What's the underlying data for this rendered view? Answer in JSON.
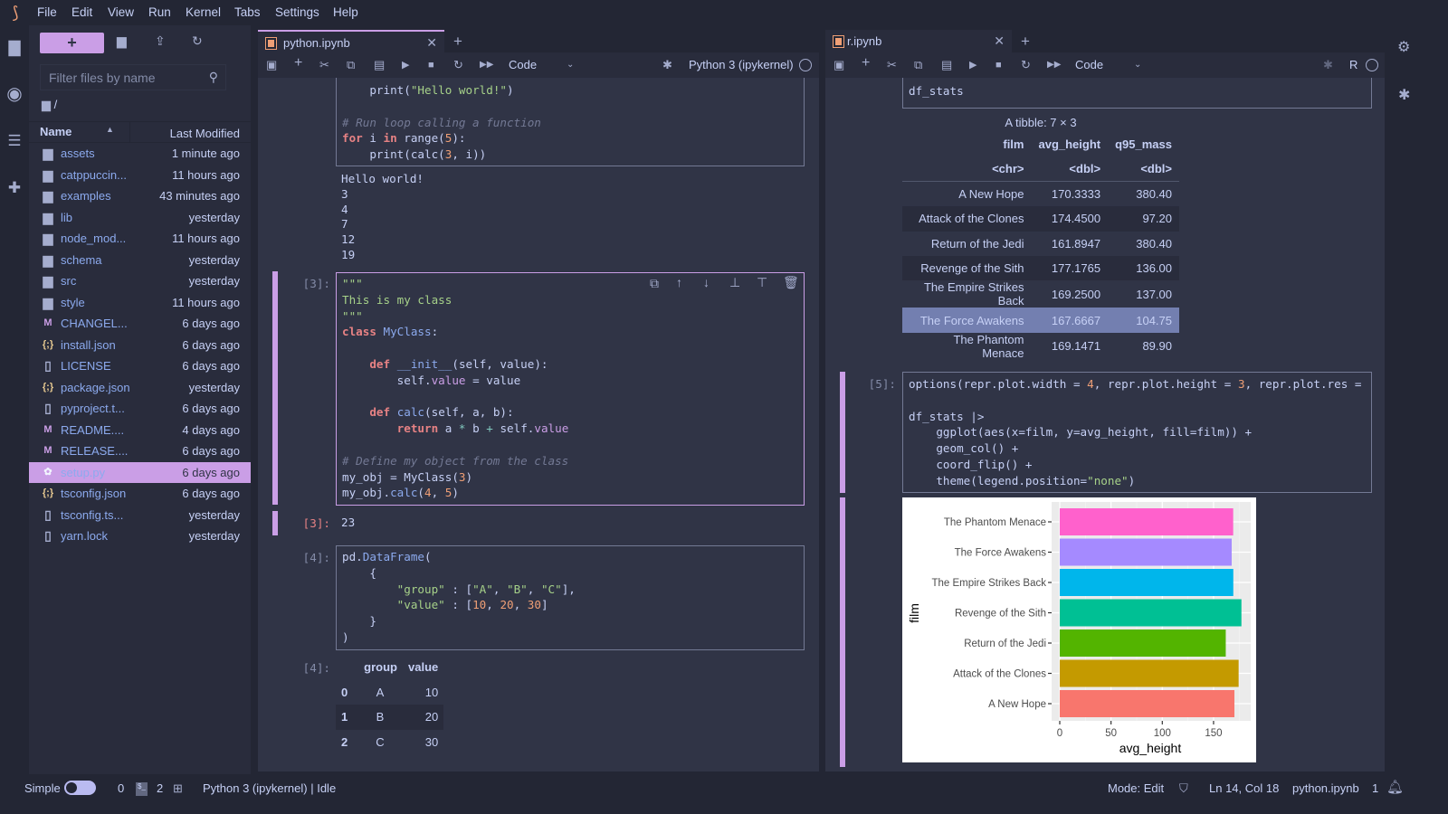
{
  "menu": [
    "File",
    "Edit",
    "View",
    "Run",
    "Kernel",
    "Tabs",
    "Settings",
    "Help"
  ],
  "filebrowser": {
    "filter_placeholder": "Filter files by name",
    "breadcrumb": "/",
    "col_name": "Name",
    "col_modified": "Last Modified",
    "files": [
      {
        "name": "assets",
        "modified": "1 minute ago",
        "type": "folder"
      },
      {
        "name": "catppuccin...",
        "modified": "11 hours ago",
        "type": "folder"
      },
      {
        "name": "examples",
        "modified": "43 minutes ago",
        "type": "folder"
      },
      {
        "name": "lib",
        "modified": "yesterday",
        "type": "folder"
      },
      {
        "name": "node_mod...",
        "modified": "11 hours ago",
        "type": "folder"
      },
      {
        "name": "schema",
        "modified": "yesterday",
        "type": "folder"
      },
      {
        "name": "src",
        "modified": "yesterday",
        "type": "folder"
      },
      {
        "name": "style",
        "modified": "11 hours ago",
        "type": "folder"
      },
      {
        "name": "CHANGEL...",
        "modified": "6 days ago",
        "type": "markdown"
      },
      {
        "name": "install.json",
        "modified": "6 days ago",
        "type": "json"
      },
      {
        "name": "LICENSE",
        "modified": "6 days ago",
        "type": "file"
      },
      {
        "name": "package.json",
        "modified": "yesterday",
        "type": "json"
      },
      {
        "name": "pyproject.t...",
        "modified": "6 days ago",
        "type": "file"
      },
      {
        "name": "README....",
        "modified": "4 days ago",
        "type": "markdown"
      },
      {
        "name": "RELEASE....",
        "modified": "6 days ago",
        "type": "markdown"
      },
      {
        "name": "setup.py",
        "modified": "6 days ago",
        "type": "python",
        "selected": true
      },
      {
        "name": "tsconfig.json",
        "modified": "6 days ago",
        "type": "json"
      },
      {
        "name": "tsconfig.ts...",
        "modified": "yesterday",
        "type": "file"
      },
      {
        "name": "yarn.lock",
        "modified": "yesterday",
        "type": "file"
      }
    ]
  },
  "python_nb": {
    "tab": "python.ipynb",
    "cell_type": "Code",
    "kernel": "Python 3 (ipykernel)",
    "cell1_code": [
      [
        [
          "",
          "    print("
        ],
        [
          "st",
          "\"Hello world!\""
        ],
        [
          "",
          ")"
        ]
      ],
      [],
      [
        [
          "cm",
          "# Run loop calling a function"
        ]
      ],
      [
        [
          "kw",
          "for"
        ],
        [
          "",
          " i "
        ],
        [
          "kw",
          "in"
        ],
        [
          "",
          " range("
        ],
        [
          "nu",
          "5"
        ],
        [
          "",
          "):"
        ]
      ],
      [
        [
          "",
          "    print(calc("
        ],
        [
          "nu",
          "3"
        ],
        [
          "",
          ", i))"
        ]
      ]
    ],
    "cell1_output": [
      "Hello world!",
      "3",
      "4",
      "7",
      "12",
      "19"
    ],
    "cell3_prompt": "[3]:",
    "cell3_code": [
      [
        [
          "st",
          "\"\"\""
        ]
      ],
      [
        [
          "st",
          "This is my class"
        ]
      ],
      [
        [
          "st",
          "\"\"\""
        ]
      ],
      [
        [
          "kw",
          "class"
        ],
        [
          "",
          " "
        ],
        [
          "fn",
          "MyClass"
        ],
        [
          "",
          ":"
        ]
      ],
      [],
      [
        [
          "",
          "    "
        ],
        [
          "kw",
          "def"
        ],
        [
          "",
          " "
        ],
        [
          "fn",
          "__init__"
        ],
        [
          "",
          "(self, value):"
        ]
      ],
      [
        [
          "",
          "        self."
        ],
        [
          "at",
          "value"
        ],
        [
          "",
          " = value"
        ]
      ],
      [],
      [
        [
          "",
          "    "
        ],
        [
          "kw",
          "def"
        ],
        [
          "",
          " "
        ],
        [
          "fn",
          "calc"
        ],
        [
          "",
          "(self, a, b):"
        ]
      ],
      [
        [
          "",
          "        "
        ],
        [
          "kw",
          "return"
        ],
        [
          "",
          " a "
        ],
        [
          "op",
          "*"
        ],
        [
          "",
          " b "
        ],
        [
          "op",
          "+"
        ],
        [
          "",
          " self."
        ],
        [
          "at",
          "value"
        ]
      ],
      [],
      [
        [
          "cm",
          "# Define my object from the class"
        ]
      ],
      [
        [
          "",
          "my_obj = MyClass("
        ],
        [
          "nu",
          "3"
        ],
        [
          "",
          ")"
        ]
      ],
      [
        [
          "",
          "my_obj."
        ],
        [
          "fn",
          "calc"
        ],
        [
          "",
          "("
        ],
        [
          "nu",
          "4"
        ],
        [
          "",
          ", "
        ],
        [
          "nu",
          "5"
        ],
        [
          "",
          ")"
        ]
      ]
    ],
    "cell3_out_prompt": "[3]:",
    "cell3_output": "23",
    "cell4_prompt": "[4]:",
    "cell4_code": [
      [
        [
          "",
          "pd."
        ],
        [
          "fn",
          "DataFrame"
        ],
        [
          "",
          "("
        ]
      ],
      [
        [
          "",
          "    {"
        ]
      ],
      [
        [
          "",
          "        "
        ],
        [
          "st",
          "\"group\""
        ],
        [
          "",
          " : ["
        ],
        [
          "st",
          "\"A\""
        ],
        [
          "",
          ", "
        ],
        [
          "st",
          "\"B\""
        ],
        [
          "",
          ", "
        ],
        [
          "st",
          "\"C\""
        ],
        [
          "",
          "],"
        ]
      ],
      [
        [
          "",
          "        "
        ],
        [
          "st",
          "\"value\""
        ],
        [
          "",
          " : ["
        ],
        [
          "nu",
          "10"
        ],
        [
          "",
          ", "
        ],
        [
          "nu",
          "20"
        ],
        [
          "",
          ", "
        ],
        [
          "nu",
          "30"
        ],
        [
          "",
          "]"
        ]
      ],
      [
        [
          "",
          "    }"
        ]
      ],
      [
        [
          "",
          ")"
        ]
      ]
    ],
    "cell4_out_prompt": "[4]:",
    "cell4_table": {
      "columns": [
        "",
        "group",
        "value"
      ],
      "rows": [
        [
          "0",
          "A",
          "10"
        ],
        [
          "1",
          "B",
          "20"
        ],
        [
          "2",
          "C",
          "30"
        ]
      ]
    }
  },
  "r_nb": {
    "tab": "r.ipynb",
    "cell_type": "Code",
    "kernel": "R",
    "cell_df_code": "df_stats",
    "tibble_caption": "A tibble: 7 × 3",
    "tibble_columns": [
      "film",
      "avg_height",
      "q95_mass"
    ],
    "tibble_types": [
      "<chr>",
      "<dbl>",
      "<dbl>"
    ],
    "tibble_rows": [
      [
        "A New Hope",
        "170.3333",
        "380.40"
      ],
      [
        "Attack of the Clones",
        "174.4500",
        "97.20"
      ],
      [
        "Return of the Jedi",
        "161.8947",
        "380.40"
      ],
      [
        "Revenge of the Sith",
        "177.1765",
        "136.00"
      ],
      [
        "The Empire Strikes Back",
        "169.2500",
        "137.00"
      ],
      [
        "The Force Awakens",
        "167.6667",
        "104.75"
      ],
      [
        "The Phantom Menace",
        "169.1471",
        "89.90"
      ]
    ],
    "tibble_highlight_row": 5,
    "cell5_prompt": "[5]:",
    "cell5_code": [
      [
        [
          "",
          "options(repr.plot.width = "
        ],
        [
          "nu",
          "4"
        ],
        [
          "",
          ", repr.plot.height = "
        ],
        [
          "nu",
          "3"
        ],
        [
          "",
          ", repr.plot.res = "
        ]
      ],
      [],
      [
        [
          "",
          "df_stats |>"
        ]
      ],
      [
        [
          "",
          "    ggplot(aes(x=film, y=avg_height, fill=film)) +"
        ]
      ],
      [
        [
          "",
          "    geom_col() +"
        ]
      ],
      [
        [
          "",
          "    coord_flip() +"
        ]
      ],
      [
        [
          "",
          "    theme(legend.position="
        ],
        [
          "st",
          "\"none\""
        ],
        [
          "",
          ")"
        ]
      ]
    ]
  },
  "chart_data": {
    "type": "bar",
    "orientation": "horizontal",
    "categories": [
      "The Phantom Menace",
      "The Force Awakens",
      "The Empire Strikes Back",
      "Revenge of the Sith",
      "Return of the Jedi",
      "Attack of the Clones",
      "A New Hope"
    ],
    "values": [
      169.1471,
      167.6667,
      169.25,
      177.1765,
      161.8947,
      174.45,
      170.3333
    ],
    "colors": [
      "#FF61CC",
      "#A58AFF",
      "#00B6EB",
      "#00C094",
      "#53B400",
      "#C49A00",
      "#F8766D"
    ],
    "xlabel": "avg_height",
    "ylabel": "film",
    "ticks": [
      0,
      50,
      100,
      150
    ],
    "xlim": [
      0,
      186
    ],
    "grid": true,
    "legend": "none"
  },
  "status": {
    "mode_label": "Simple",
    "terminals": "0",
    "kernels": "2",
    "kernel_status": "Python 3 (ipykernel) | Idle",
    "mode": "Mode: Edit",
    "cursor": "Ln 14, Col 18",
    "file": "python.ipynb",
    "notifications": "1"
  },
  "colors": {
    "accent": "#ca9ee6",
    "background": "#303446",
    "sidebar": "#292c3c",
    "crust": "#232634"
  }
}
